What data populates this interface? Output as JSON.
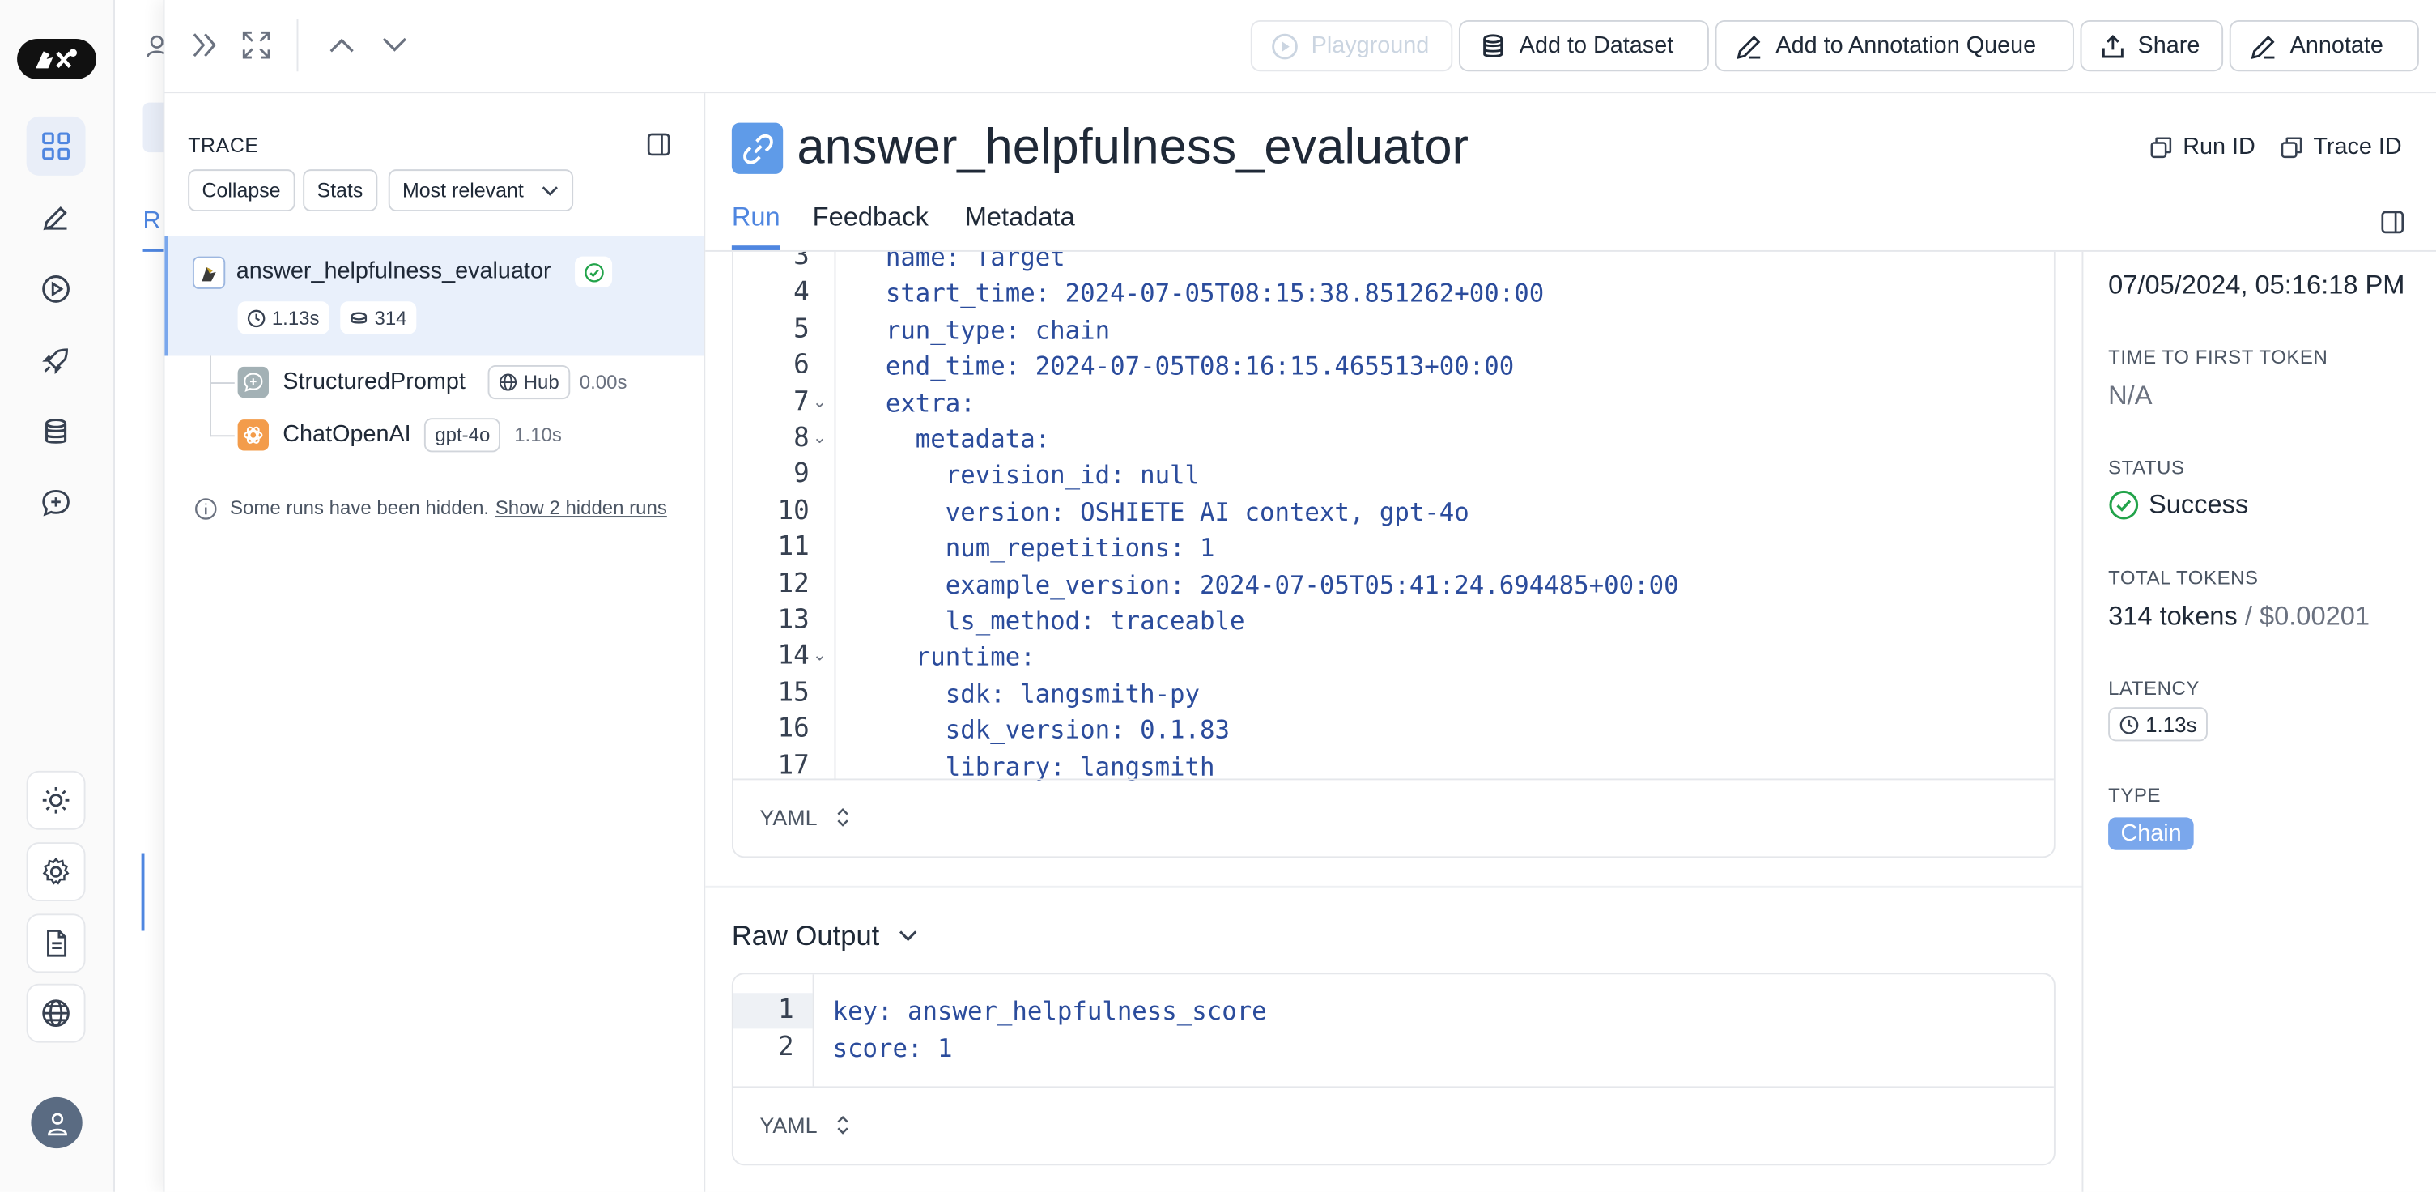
{
  "rail": {
    "items": [
      "logo",
      "dashboard",
      "edit",
      "play",
      "rocket",
      "database",
      "chat-plus"
    ],
    "bottom": [
      "sun",
      "gear",
      "document",
      "globe",
      "avatar"
    ]
  },
  "bg": {
    "tab_letter": "R"
  },
  "toolbar": {
    "playground": "Playground",
    "add_to_dataset": "Add to Dataset",
    "add_to_annotation_queue": "Add to Annotation Queue",
    "share": "Share",
    "annotate": "Annotate"
  },
  "trace": {
    "title": "TRACE",
    "collapse": "Collapse",
    "stats": "Stats",
    "sort": "Most relevant",
    "root": {
      "name": "answer_helpfulness_evaluator",
      "latency": "1.13s",
      "tokens": "314"
    },
    "children": [
      {
        "name": "StructuredPrompt",
        "tag": "Hub",
        "latency": "0.00s"
      },
      {
        "name": "ChatOpenAI",
        "tag": "gpt-4o",
        "latency": "1.10s"
      }
    ],
    "hidden_note": "Some runs have been hidden.",
    "hidden_link": "Show 2 hidden runs"
  },
  "run": {
    "title": "answer_helpfulness_evaluator",
    "run_id": "Run ID",
    "trace_id": "Trace ID",
    "tabs": [
      "Run",
      "Feedback",
      "Metadata"
    ],
    "input_code": {
      "lines": [
        {
          "n": "3",
          "t": "name: Target"
        },
        {
          "n": "4",
          "t": "start_time: 2024-07-05T08:15:38.851262+00:00"
        },
        {
          "n": "5",
          "t": "run_type: chain"
        },
        {
          "n": "6",
          "t": "end_time: 2024-07-05T08:16:15.465513+00:00"
        },
        {
          "n": "7",
          "t": "extra:"
        },
        {
          "n": "8",
          "t": "  metadata:"
        },
        {
          "n": "9",
          "t": "    revision_id: null"
        },
        {
          "n": "10",
          "t": "    version: OSHIETE AI context, gpt-4o"
        },
        {
          "n": "11",
          "t": "    num_repetitions: 1"
        },
        {
          "n": "12",
          "t": "    example_version: 2024-07-05T05:41:24.694485+00:00"
        },
        {
          "n": "13",
          "t": "    ls_method: traceable"
        },
        {
          "n": "14",
          "t": "  runtime:"
        },
        {
          "n": "15",
          "t": "    sdk: langsmith-py"
        },
        {
          "n": "16",
          "t": "    sdk_version: 0.1.83"
        },
        {
          "n": "17",
          "t": "    library: langsmith"
        }
      ],
      "format": "YAML"
    },
    "raw_output": {
      "title": "Raw Output",
      "lines": [
        {
          "n": "1",
          "t": "key: answer_helpfulness_score"
        },
        {
          "n": "2",
          "t": "score: 1"
        }
      ],
      "format": "YAML"
    }
  },
  "details": {
    "start_time": "07/05/2024, 05:16:18 PM",
    "ttft_label": "TIME TO FIRST TOKEN",
    "ttft": "N/A",
    "status_label": "STATUS",
    "status": "Success",
    "tokens_label": "TOTAL TOKENS",
    "tokens": "314 tokens",
    "cost": "/ $0.00201",
    "latency_label": "LATENCY",
    "latency": "1.13s",
    "type_label": "TYPE",
    "type": "Chain"
  },
  "colors": {
    "accent": "#4f86e0",
    "success": "#22a34a",
    "chain_badge": "#7aa7ec",
    "orange": "#f39c4b"
  }
}
